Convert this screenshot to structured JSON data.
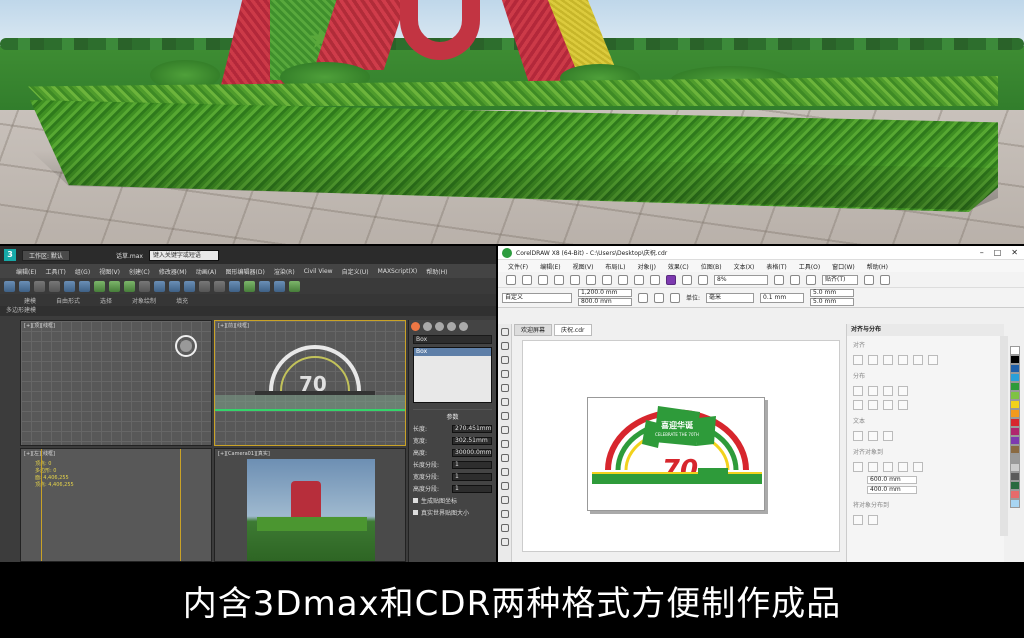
{
  "caption": "内含3Dmax和CDR两种格式方便制作成品",
  "max": {
    "logo": "3",
    "workspace": "工作区: 默认",
    "filename": "话草.max",
    "search": "键入关键字或短语",
    "menus": [
      "编辑(E)",
      "工具(T)",
      "组(G)",
      "视图(V)",
      "创建(C)",
      "修改器(M)",
      "动画(A)",
      "图形编辑器(D)",
      "渲染(R)",
      "Civil View",
      "自定义(U)",
      "MAXScript(X)",
      "帮助(H)"
    ],
    "ribbon": [
      "建模",
      "自由形式",
      "选择",
      "对象绘制",
      "填充"
    ],
    "ribbon2": "多边形建模",
    "viewports": {
      "top": "[+][顶][线框]",
      "front": "[+][前][线框]",
      "left": "[+][左][线框]",
      "persp": "[+][Camera01][真实]"
    },
    "left_info": [
      "顶点: 0",
      "多边形: 0",
      "面: 4,406,255",
      "顶点: 4,406,255"
    ],
    "panel": {
      "object_field": "Box",
      "list_sel": "Box",
      "section": "参数",
      "rows": [
        {
          "label": "长度:",
          "value": "270.451mm"
        },
        {
          "label": "宽度:",
          "value": "302.51mm"
        },
        {
          "label": "高度:",
          "value": "30000.0mm"
        },
        {
          "label": "长度分段:",
          "value": "1"
        },
        {
          "label": "宽度分段:",
          "value": "1"
        },
        {
          "label": "高度分段:",
          "value": "1"
        }
      ],
      "checks": [
        "生成贴图坐标",
        "真实世界贴图大小"
      ]
    }
  },
  "cdr": {
    "title": "CorelDRAW X8 (64-Bit) - C:\\Users\\Desktop\\庆祝.cdr",
    "menus": [
      "文件(F)",
      "编辑(E)",
      "视图(V)",
      "布局(L)",
      "对象(J)",
      "效果(C)",
      "位图(B)",
      "文本(X)",
      "表格(T)",
      "工具(O)",
      "窗口(W)",
      "帮助(H)"
    ],
    "zoom": "8%",
    "snap": "贴齐(T)",
    "preset": "自定义",
    "size_w": "1,200.0 mm",
    "size_h": "800.0 mm",
    "unit_label": "单位:",
    "unit": "毫米",
    "nudge": "0.1 mm",
    "dup_x": "5.0 mm",
    "dup_y": "5.0 mm",
    "tabs": [
      "欢迎屏幕",
      "庆祝.cdr"
    ],
    "dock_title": "对齐与分布",
    "dock_sub1": "对齐",
    "dock_sub2": "分布",
    "dock_sub3": "文本",
    "dock_sub4": "对齐对象到",
    "dock_sub5": "将对象分布到",
    "dock_x": "600.0 mm",
    "dock_y": "400.0 mm",
    "design_text": "喜迎华诞",
    "design_sub": "CELEBRATE THE 70TH",
    "design_num": "70"
  },
  "colors": {
    "accent_green": "#2e9b3a",
    "accent_red": "#d7262d",
    "yellow": "#f2d21c"
  }
}
